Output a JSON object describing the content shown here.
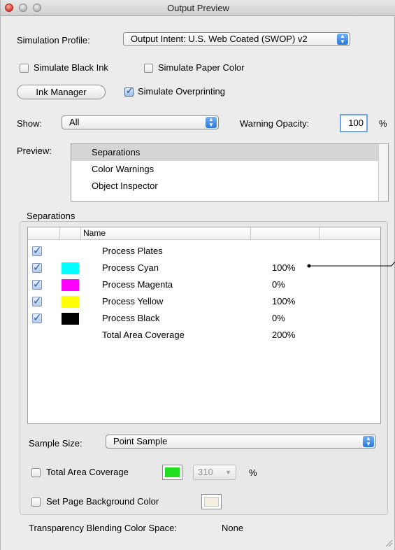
{
  "window": {
    "title": "Output Preview"
  },
  "simulation": {
    "label": "Simulation Profile:",
    "value": "Output Intent: U.S. Web Coated (SWOP) v2"
  },
  "options": {
    "simulate_black_ink": {
      "label": "Simulate Black Ink",
      "checked": false
    },
    "simulate_paper_color": {
      "label": "Simulate Paper Color",
      "checked": false
    },
    "simulate_overprinting": {
      "label": "Simulate Overprinting",
      "checked": true
    }
  },
  "ink_manager_label": "Ink Manager",
  "show": {
    "label": "Show:",
    "value": "All"
  },
  "warning_opacity": {
    "label": "Warning Opacity:",
    "value": "100",
    "unit": "%"
  },
  "preview": {
    "label": "Preview:",
    "items": [
      "Separations",
      "Color Warnings",
      "Object Inspector"
    ],
    "selected": "Separations"
  },
  "separations": {
    "label": "Separations",
    "columns": [
      "",
      "",
      "Name",
      "",
      ""
    ],
    "rows": [
      {
        "name": "Process Plates",
        "checked": true,
        "color": null,
        "value": ""
      },
      {
        "name": "Process Cyan",
        "checked": true,
        "color": "#00ffff",
        "value": "100%"
      },
      {
        "name": "Process Magenta",
        "checked": true,
        "color": "#ff00ff",
        "value": "0%"
      },
      {
        "name": "Process Yellow",
        "checked": true,
        "color": "#ffff00",
        "value": "100%"
      },
      {
        "name": "Process Black",
        "checked": true,
        "color": "#000000",
        "value": "0%"
      },
      {
        "name": "Total Area Coverage",
        "checked": false,
        "color": null,
        "value": "200%"
      }
    ]
  },
  "sample_size": {
    "label": "Sample Size:",
    "value": "Point Sample"
  },
  "total_area_coverage": {
    "label": "Total Area Coverage",
    "checked": false,
    "color": "#22dd22",
    "value": "310",
    "unit": "%"
  },
  "page_background": {
    "label": "Set Page Background Color",
    "checked": false,
    "color": "#f2efe0"
  },
  "transparency": {
    "label": "Transparency Blending Color Space:",
    "value": "None"
  }
}
